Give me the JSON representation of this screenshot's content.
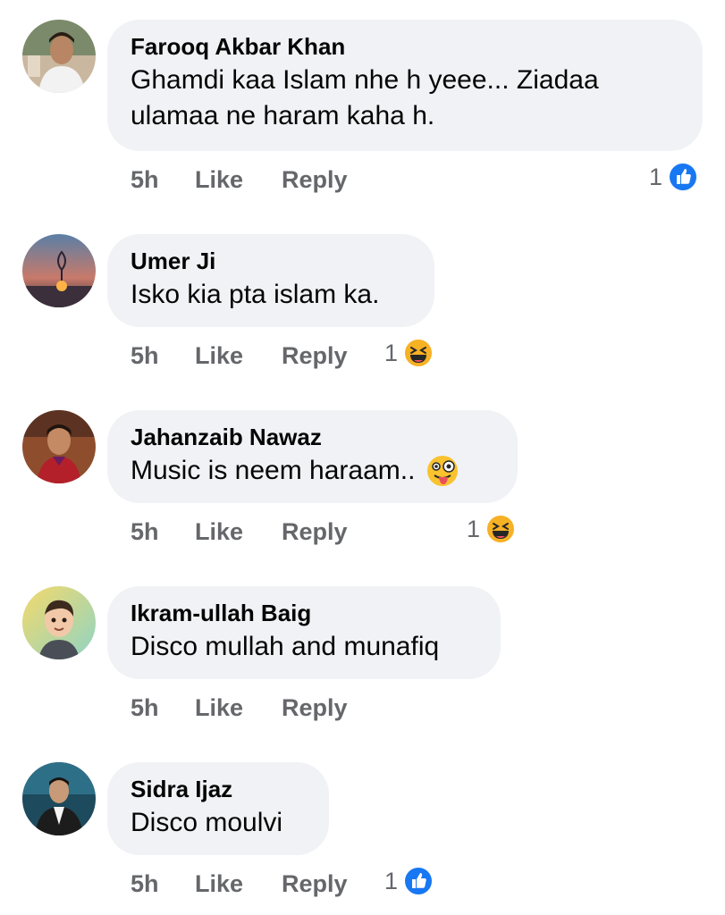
{
  "comments": [
    {
      "author": "Farooq Akbar Khan",
      "text_lines": [
        "Ghamdi kaa Islam nhe h yeee... Ziadaa",
        "ulamaa ne haram kaha h."
      ],
      "time": "5h",
      "like": "Like",
      "reply": "Reply",
      "reaction": {
        "count": "1",
        "icon": "like-icon"
      }
    },
    {
      "author": "Umer Ji",
      "text_lines": [
        "Isko kia pta islam ka."
      ],
      "time": "5h",
      "like": "Like",
      "reply": "Reply",
      "reaction": {
        "count": "1",
        "icon": "haha-icon"
      }
    },
    {
      "author": "Jahanzaib Nawaz",
      "text_lines": [
        "Music is neem haraam.."
      ],
      "text_emoji": "winking-tongue-emoji",
      "time": "5h",
      "like": "Like",
      "reply": "Reply",
      "reaction": {
        "count": "1",
        "icon": "haha-icon"
      }
    },
    {
      "author": "Ikram-ullah Baig",
      "text_lines": [
        "Disco mullah and munafiq"
      ],
      "time": "5h",
      "like": "Like",
      "reply": "Reply",
      "reaction": null
    },
    {
      "author": "Sidra Ijaz",
      "text_lines": [
        "Disco moulvi"
      ],
      "time": "5h",
      "like": "Like",
      "reply": "Reply",
      "reaction": {
        "count": "1",
        "icon": "like-icon"
      }
    }
  ],
  "colors": {
    "bubble": "#f0f2f5",
    "meta": "#65676b",
    "like_blue": "#1877f2",
    "haha_yellow": "#f7b125"
  }
}
